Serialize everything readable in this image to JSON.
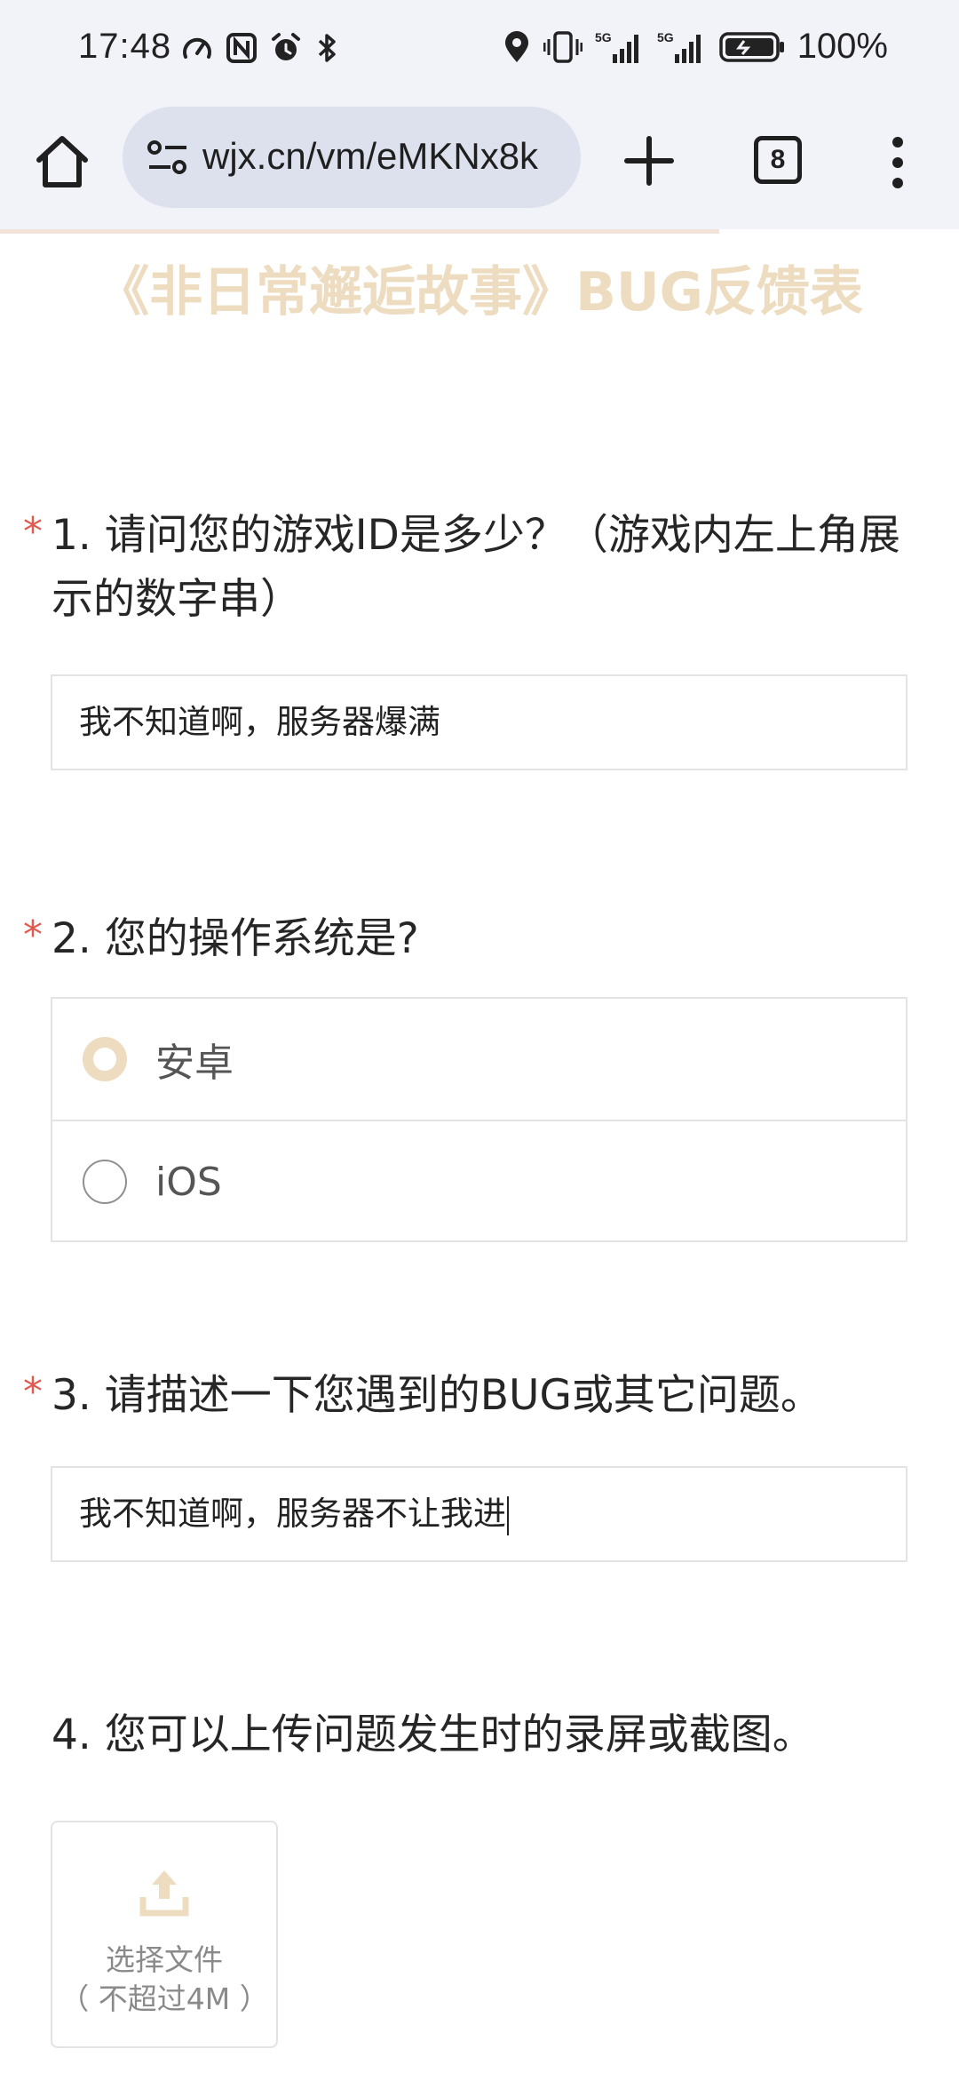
{
  "status_bar": {
    "time": "17:48",
    "battery": "100%",
    "icons": [
      "speedometer-icon",
      "nfc-icon",
      "alarm-icon",
      "bluetooth-icon",
      "location-icon",
      "vibrate-icon",
      "signal-5g-icon",
      "signal-5g-icon",
      "battery-icon"
    ]
  },
  "browser": {
    "url": "wjx.cn/vm/eMKNx8k",
    "tab_count": "8",
    "progress_percent": 75
  },
  "form": {
    "title": "《非日常邂逅故事》BUG反馈表",
    "questions": [
      {
        "number": "1.",
        "text": "请问您的游戏ID是多少？（游戏内左上角展示的数字串）",
        "required": true,
        "answer": "我不知道啊，服务器爆满"
      },
      {
        "number": "2.",
        "text": "您的操作系统是?",
        "required": true,
        "options": [
          "安卓",
          "iOS"
        ],
        "selected": "安卓"
      },
      {
        "number": "3.",
        "text": "请描述一下您遇到的BUG或其它问题。",
        "required": true,
        "answer": "我不知道啊，服务器不让我进"
      },
      {
        "number": "4.",
        "text": "您可以上传问题发生时的录屏或截图。",
        "required": false,
        "upload_label": "选择文件",
        "upload_limit": "（ 不超过4M ）"
      }
    ]
  },
  "colors": {
    "accent": "#eddcc0",
    "required_star": "#e05a4f",
    "chrome_bg": "#f2f2f9",
    "url_bg": "#dde1ee"
  }
}
